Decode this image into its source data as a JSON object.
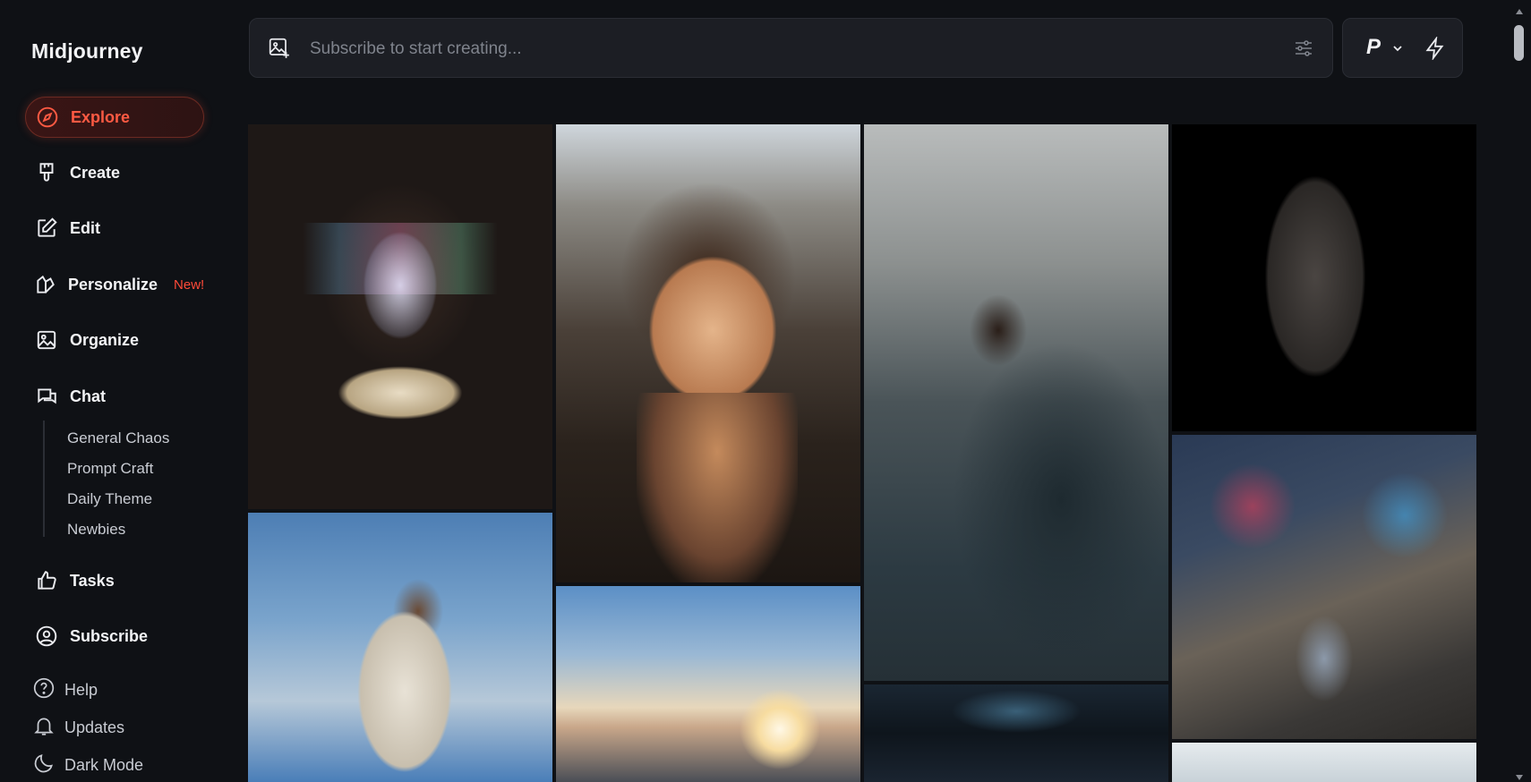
{
  "app": {
    "name": "Midjourney"
  },
  "sidebar": {
    "nav": [
      {
        "label": "Explore",
        "icon": "compass-icon",
        "active": true
      },
      {
        "label": "Create",
        "icon": "paintbrush-icon"
      },
      {
        "label": "Edit",
        "icon": "edit-icon"
      },
      {
        "label": "Personalize",
        "icon": "personalize-icon",
        "badge": "New!"
      },
      {
        "label": "Organize",
        "icon": "image-icon"
      },
      {
        "label": "Chat",
        "icon": "chat-icon"
      }
    ],
    "chat_rooms": [
      "General Chaos",
      "Prompt Craft",
      "Daily Theme",
      "Newbies"
    ],
    "nav2": [
      {
        "label": "Tasks",
        "icon": "thumbs-up-icon"
      },
      {
        "label": "Subscribe",
        "icon": "account-circle-icon"
      }
    ],
    "footer": [
      {
        "label": "Help",
        "icon": "help-icon"
      },
      {
        "label": "Updates",
        "icon": "bell-icon"
      },
      {
        "label": "Dark Mode",
        "icon": "moon-icon"
      }
    ]
  },
  "prompt": {
    "placeholder": "Subscribe to start creating...",
    "mode_label": "P"
  },
  "colors": {
    "accent": "#ff5a43",
    "background": "#0f1115",
    "panel": "#1c1e24"
  }
}
